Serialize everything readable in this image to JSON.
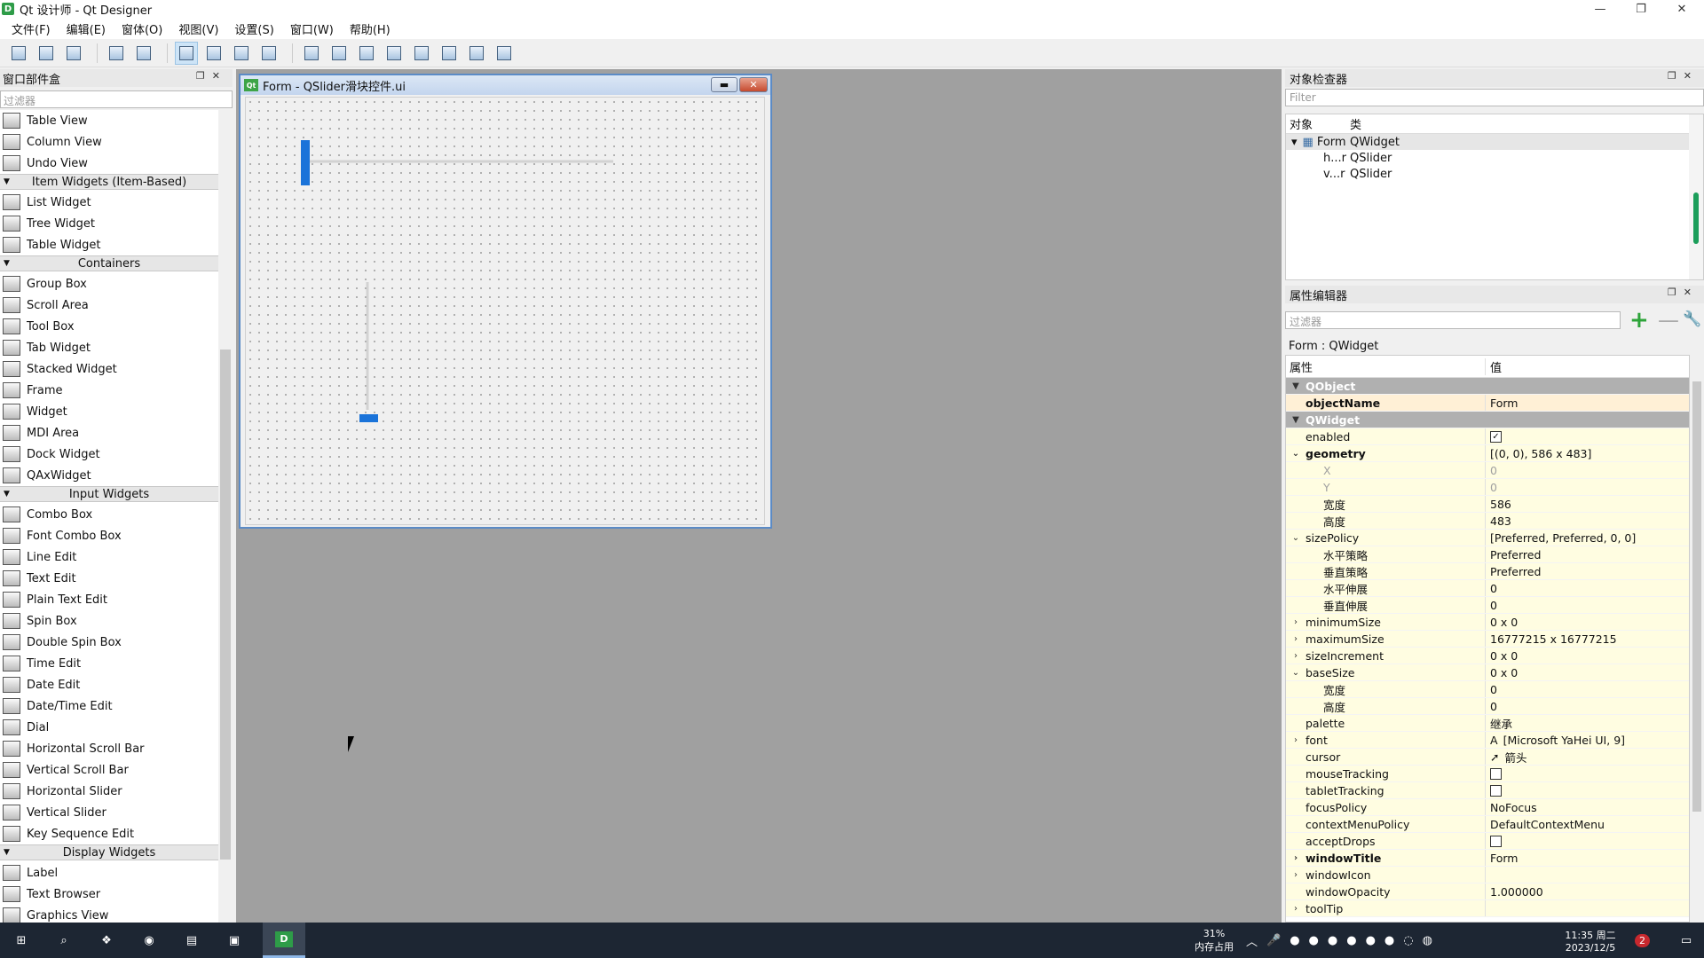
{
  "window": {
    "app_icon": "D",
    "title": "Qt 设计师 - Qt Designer"
  },
  "menu": [
    "文件(F)",
    "编辑(E)",
    "窗体(O)",
    "视图(V)",
    "设置(S)",
    "窗口(W)",
    "帮助(H)"
  ],
  "widget_box": {
    "title": "窗口部件盒",
    "filter_placeholder": "过滤器",
    "items": [
      {
        "type": "item",
        "label": "Table View"
      },
      {
        "type": "item",
        "label": "Column View"
      },
      {
        "type": "item",
        "label": "Undo View"
      },
      {
        "type": "category",
        "label": "Item Widgets (Item-Based)"
      },
      {
        "type": "item",
        "label": "List Widget"
      },
      {
        "type": "item",
        "label": "Tree Widget"
      },
      {
        "type": "item",
        "label": "Table Widget"
      },
      {
        "type": "category",
        "label": "Containers"
      },
      {
        "type": "item",
        "label": "Group Box"
      },
      {
        "type": "item",
        "label": "Scroll Area"
      },
      {
        "type": "item",
        "label": "Tool Box"
      },
      {
        "type": "item",
        "label": "Tab Widget"
      },
      {
        "type": "item",
        "label": "Stacked Widget"
      },
      {
        "type": "item",
        "label": "Frame"
      },
      {
        "type": "item",
        "label": "Widget"
      },
      {
        "type": "item",
        "label": "MDI Area"
      },
      {
        "type": "item",
        "label": "Dock Widget"
      },
      {
        "type": "item",
        "label": "QAxWidget"
      },
      {
        "type": "category",
        "label": "Input Widgets"
      },
      {
        "type": "item",
        "label": "Combo Box"
      },
      {
        "type": "item",
        "label": "Font Combo Box"
      },
      {
        "type": "item",
        "label": "Line Edit"
      },
      {
        "type": "item",
        "label": "Text Edit"
      },
      {
        "type": "item",
        "label": "Plain Text Edit"
      },
      {
        "type": "item",
        "label": "Spin Box"
      },
      {
        "type": "item",
        "label": "Double Spin Box"
      },
      {
        "type": "item",
        "label": "Time Edit"
      },
      {
        "type": "item",
        "label": "Date Edit"
      },
      {
        "type": "item",
        "label": "Date/Time Edit"
      },
      {
        "type": "item",
        "label": "Dial"
      },
      {
        "type": "item",
        "label": "Horizontal Scroll Bar"
      },
      {
        "type": "item",
        "label": "Vertical Scroll Bar"
      },
      {
        "type": "item",
        "label": "Horizontal Slider"
      },
      {
        "type": "item",
        "label": "Vertical Slider"
      },
      {
        "type": "item",
        "label": "Key Sequence Edit"
      },
      {
        "type": "category",
        "label": "Display Widgets"
      },
      {
        "type": "item",
        "label": "Label"
      },
      {
        "type": "item",
        "label": "Text Browser"
      },
      {
        "type": "item",
        "label": "Graphics View"
      }
    ]
  },
  "form": {
    "title": "Form - QSlider滑块控件.ui",
    "horizontal_slider_value": 0,
    "vertical_slider_value": 0
  },
  "object_inspector": {
    "title": "对象检查器",
    "filter_placeholder": "Filter",
    "col_object": "对象",
    "col_class": "类",
    "rows": [
      {
        "name": "Form",
        "cls": "QWidget"
      },
      {
        "name": "h...r",
        "cls": "QSlider"
      },
      {
        "name": "v...r",
        "cls": "QSlider"
      }
    ]
  },
  "property_editor": {
    "title": "属性编辑器",
    "filter_placeholder": "过滤器",
    "class_label": "Form : QWidget",
    "col_property": "属性",
    "col_value": "值",
    "rows": [
      {
        "k": "grp",
        "n": "QObject",
        "v": ""
      },
      {
        "k": "o b",
        "n": "objectName",
        "v": "Form",
        "ind": 0
      },
      {
        "k": "grp",
        "n": "QWidget",
        "v": ""
      },
      {
        "k": "y",
        "n": "enabled",
        "v": "",
        "chk": true
      },
      {
        "k": "y b",
        "n": "geometry",
        "v": "[(0, 0), 586 x 483]",
        "exp": "v"
      },
      {
        "k": "y dim",
        "n": "X",
        "v": "0",
        "ind": 1
      },
      {
        "k": "y dim",
        "n": "Y",
        "v": "0",
        "ind": 1
      },
      {
        "k": "y",
        "n": "宽度",
        "v": "586",
        "ind": 1
      },
      {
        "k": "y",
        "n": "高度",
        "v": "483",
        "ind": 1
      },
      {
        "k": "y",
        "n": "sizePolicy",
        "v": "[Preferred, Preferred, 0, 0]",
        "exp": "v"
      },
      {
        "k": "y",
        "n": "水平策略",
        "v": "Preferred",
        "ind": 1
      },
      {
        "k": "y",
        "n": "垂直策略",
        "v": "Preferred",
        "ind": 1
      },
      {
        "k": "y",
        "n": "水平伸展",
        "v": "0",
        "ind": 1
      },
      {
        "k": "y",
        "n": "垂直伸展",
        "v": "0",
        "ind": 1
      },
      {
        "k": "y",
        "n": "minimumSize",
        "v": "0 x 0",
        "exp": ">"
      },
      {
        "k": "y",
        "n": "maximumSize",
        "v": "16777215 x 16777215",
        "exp": ">"
      },
      {
        "k": "y",
        "n": "sizeIncrement",
        "v": "0 x 0",
        "exp": ">"
      },
      {
        "k": "y",
        "n": "baseSize",
        "v": "0 x 0",
        "exp": "v"
      },
      {
        "k": "y",
        "n": "宽度",
        "v": "0",
        "ind": 1
      },
      {
        "k": "y",
        "n": "高度",
        "v": "0",
        "ind": 1
      },
      {
        "k": "y",
        "n": "palette",
        "v": "继承"
      },
      {
        "k": "y",
        "n": "font",
        "v": "[Microsoft YaHei UI, 9]",
        "exp": ">",
        "pre": "A"
      },
      {
        "k": "y",
        "n": "cursor",
        "v": "箭头",
        "pre": "➚"
      },
      {
        "k": "y",
        "n": "mouseTracking",
        "v": "",
        "chk": false
      },
      {
        "k": "y",
        "n": "tabletTracking",
        "v": "",
        "chk": false
      },
      {
        "k": "y",
        "n": "focusPolicy",
        "v": "NoFocus"
      },
      {
        "k": "y",
        "n": "contextMenuPolicy",
        "v": "DefaultContextMenu"
      },
      {
        "k": "y",
        "n": "acceptDrops",
        "v": "",
        "chk": false
      },
      {
        "k": "y b",
        "n": "windowTitle",
        "v": "Form",
        "exp": ">"
      },
      {
        "k": "y",
        "n": "windowIcon",
        "v": "",
        "exp": ">"
      },
      {
        "k": "y",
        "n": "windowOpacity",
        "v": "1.000000"
      },
      {
        "k": "y",
        "n": "toolTip",
        "v": "",
        "exp": ">"
      }
    ]
  },
  "taskbar": {
    "mem_percent": "31%",
    "mem_label": "内存占用",
    "time": "11:35 周二",
    "date": "2023/12/5",
    "badge": "2"
  },
  "colors": {
    "accent": "#1a73d9",
    "group_row": "#b0b0b0",
    "prop_row": "#fffde1"
  }
}
